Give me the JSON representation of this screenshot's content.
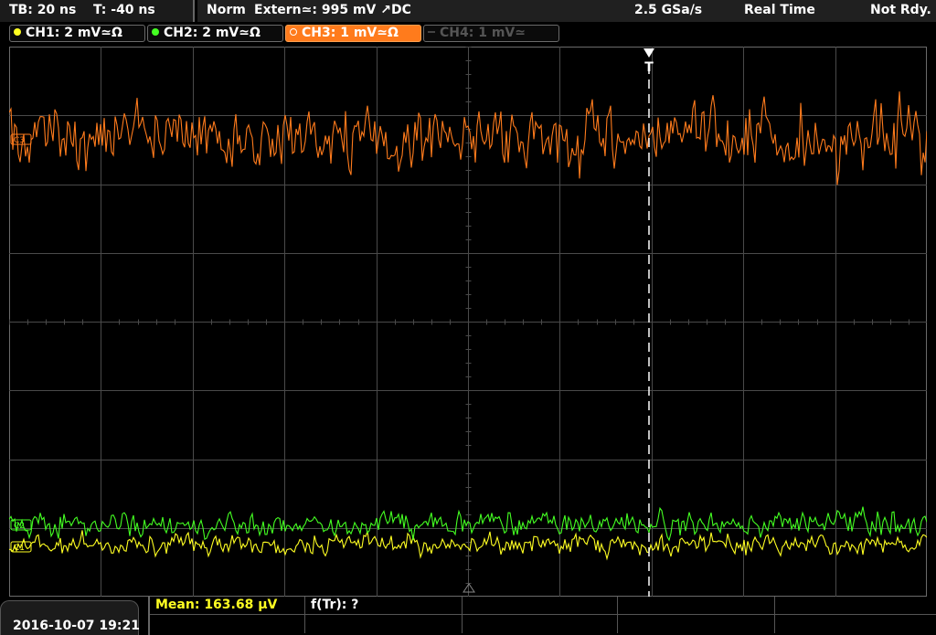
{
  "status": {
    "timebase": "TB: 20 ns",
    "trigger_time": "T: -40 ns",
    "mode": "Norm",
    "trigger_source": "Extern≃: 995 mV ↗DC",
    "sample_rate": "2.5 GSa/s",
    "acquisition": "Real Time",
    "run_state": "Not Rdy."
  },
  "channels": [
    {
      "label": "CH1: 2 mV≃Ω",
      "color": "#ffff22",
      "active": false,
      "enabled": true
    },
    {
      "label": "CH2: 2 mV≃Ω",
      "color": "#44ff22",
      "active": false,
      "enabled": true
    },
    {
      "label": "CH3: 1 mV≃Ω",
      "color": "#ff7b1c",
      "active": true,
      "enabled": true
    },
    {
      "label": "CH4: 1 mV≃",
      "color": "#555555",
      "active": false,
      "enabled": false
    }
  ],
  "markers": {
    "trigger_marker": "T",
    "ch3_label": "C3",
    "ch2_label": "C2",
    "ch1_label": "C1"
  },
  "measurements": {
    "mean": "Mean: 163.68 µV",
    "freq": "f(Tr): ?"
  },
  "datetime": "2016-10-07 19:21",
  "colors": {
    "grid": "#4a4a4a",
    "ch1": "#ffff22",
    "ch2": "#44ff22",
    "ch3": "#ff7b1c"
  }
}
